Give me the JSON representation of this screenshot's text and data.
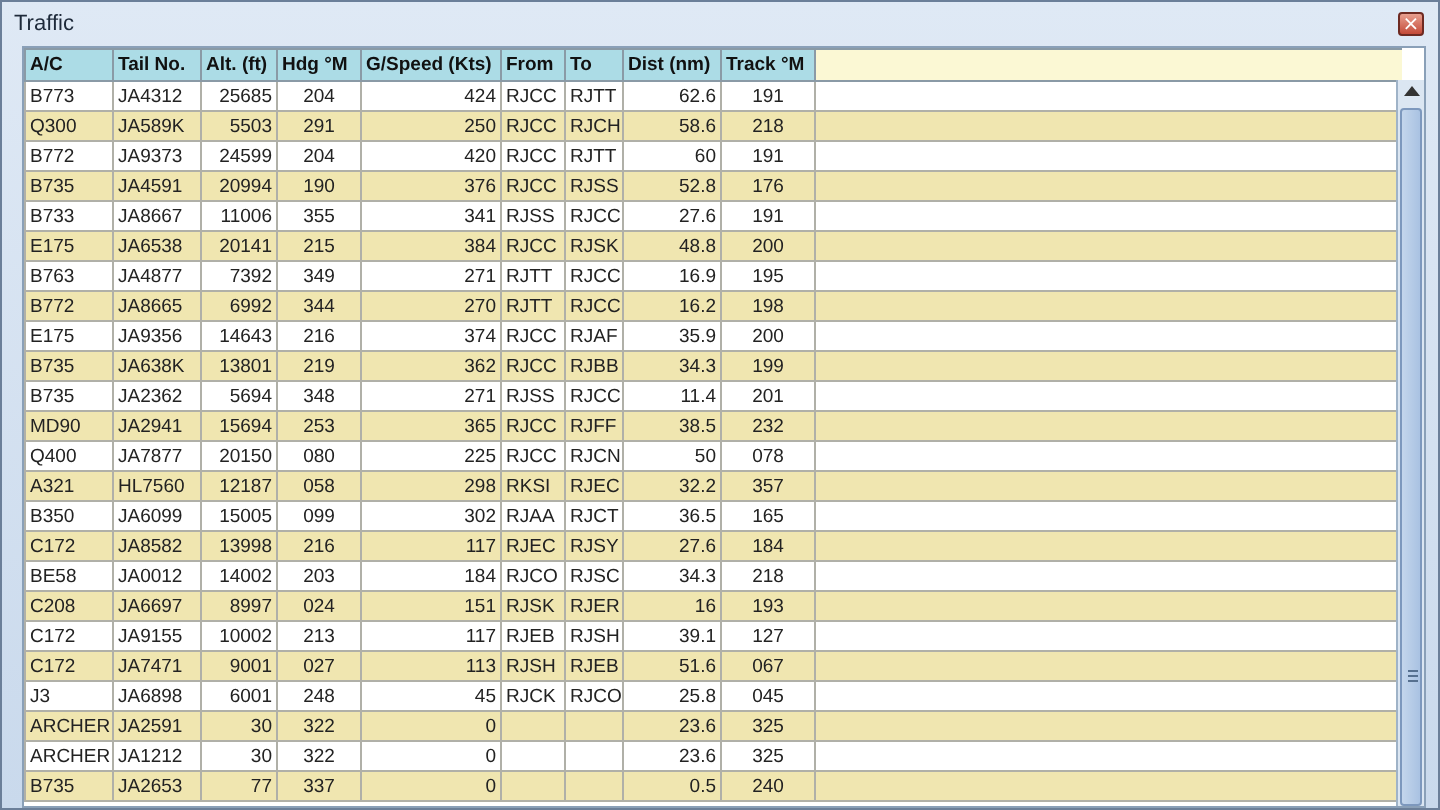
{
  "window": {
    "title": "Traffic",
    "close_button": "×"
  },
  "table": {
    "columns": [
      "A/C",
      "Tail No.",
      "Alt. (ft)",
      "Hdg °M",
      "G/Speed (Kts)",
      "From",
      "To",
      "Dist (nm)",
      "Track °M"
    ],
    "rows": [
      [
        "B773",
        "JA4312",
        "25685",
        "204",
        "424",
        "RJCC",
        "RJTT",
        "62.6",
        "191"
      ],
      [
        "Q300",
        "JA589K",
        "5503",
        "291",
        "250",
        "RJCC",
        "RJCH",
        "58.6",
        "218"
      ],
      [
        "B772",
        "JA9373",
        "24599",
        "204",
        "420",
        "RJCC",
        "RJTT",
        "60",
        "191"
      ],
      [
        "B735",
        "JA4591",
        "20994",
        "190",
        "376",
        "RJCC",
        "RJSS",
        "52.8",
        "176"
      ],
      [
        "B733",
        "JA8667",
        "11006",
        "355",
        "341",
        "RJSS",
        "RJCC",
        "27.6",
        "191"
      ],
      [
        "E175",
        "JA6538",
        "20141",
        "215",
        "384",
        "RJCC",
        "RJSK",
        "48.8",
        "200"
      ],
      [
        "B763",
        "JA4877",
        "7392",
        "349",
        "271",
        "RJTT",
        "RJCC",
        "16.9",
        "195"
      ],
      [
        "B772",
        "JA8665",
        "6992",
        "344",
        "270",
        "RJTT",
        "RJCC",
        "16.2",
        "198"
      ],
      [
        "E175",
        "JA9356",
        "14643",
        "216",
        "374",
        "RJCC",
        "RJAF",
        "35.9",
        "200"
      ],
      [
        "B735",
        "JA638K",
        "13801",
        "219",
        "362",
        "RJCC",
        "RJBB",
        "34.3",
        "199"
      ],
      [
        "B735",
        "JA2362",
        "5694",
        "348",
        "271",
        "RJSS",
        "RJCC",
        "11.4",
        "201"
      ],
      [
        "MD90",
        "JA2941",
        "15694",
        "253",
        "365",
        "RJCC",
        "RJFF",
        "38.5",
        "232"
      ],
      [
        "Q400",
        "JA7877",
        "20150",
        "080",
        "225",
        "RJCC",
        "RJCN",
        "50",
        "078"
      ],
      [
        "A321",
        "HL7560",
        "12187",
        "058",
        "298",
        "RKSI",
        "RJEC",
        "32.2",
        "357"
      ],
      [
        "B350",
        "JA6099",
        "15005",
        "099",
        "302",
        "RJAA",
        "RJCT",
        "36.5",
        "165"
      ],
      [
        "C172",
        "JA8582",
        "13998",
        "216",
        "117",
        "RJEC",
        "RJSY",
        "27.6",
        "184"
      ],
      [
        "BE58",
        "JA0012",
        "14002",
        "203",
        "184",
        "RJCO",
        "RJSC",
        "34.3",
        "218"
      ],
      [
        "C208",
        "JA6697",
        "8997",
        "024",
        "151",
        "RJSK",
        "RJER",
        "16",
        "193"
      ],
      [
        "C172",
        "JA9155",
        "10002",
        "213",
        "117",
        "RJEB",
        "RJSH",
        "39.1",
        "127"
      ],
      [
        "C172",
        "JA7471",
        "9001",
        "027",
        "113",
        "RJSH",
        "RJEB",
        "51.6",
        "067"
      ],
      [
        "J3",
        "JA6898",
        "6001",
        "248",
        "45",
        "RJCK",
        "RJCO",
        "25.8",
        "045"
      ],
      [
        "ARCHER",
        "JA2591",
        "30",
        "322",
        "0",
        null,
        null,
        "23.6",
        "325"
      ],
      [
        "ARCHER",
        "JA1212",
        "30",
        "322",
        "0",
        null,
        null,
        "23.6",
        "325"
      ],
      [
        "B735",
        "JA2653",
        "77",
        "337",
        "0",
        null,
        null,
        "0.5",
        "240"
      ]
    ]
  }
}
